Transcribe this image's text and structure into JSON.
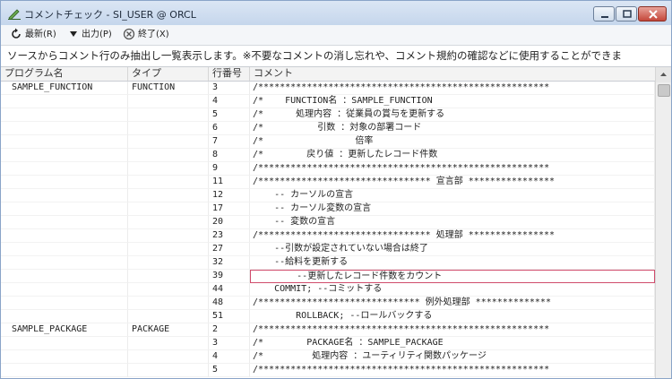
{
  "window": {
    "title": "コメントチェック - SI_USER @ ORCL",
    "controls": {
      "minimize_icon": "minimize-icon",
      "maximize_icon": "maximize-icon",
      "close_icon": "close-icon"
    }
  },
  "toolbar": {
    "refresh_label": "最新(R)",
    "output_label": "出力(P)",
    "exit_label": "終了(X)"
  },
  "info_text": "ソースからコメント行のみ抽出し一覧表示します。※不要なコメントの消し忘れや、コメント規約の確認などに使用することができま",
  "grid": {
    "columns": [
      "プログラム名",
      "タイプ",
      "行番号",
      "コメント"
    ],
    "rows": [
      {
        "program": "SAMPLE_FUNCTION",
        "type": "FUNCTION",
        "line": "3",
        "comment": "/******************************************************"
      },
      {
        "program": "",
        "type": "",
        "line": "4",
        "comment": "/*    FUNCTION名 ：SAMPLE_FUNCTION"
      },
      {
        "program": "",
        "type": "",
        "line": "5",
        "comment": "/*      処理内容 ：従業員の賞与を更新する"
      },
      {
        "program": "",
        "type": "",
        "line": "6",
        "comment": "/*          引数 ：対象の部署コード"
      },
      {
        "program": "",
        "type": "",
        "line": "7",
        "comment": "/*                 倍率"
      },
      {
        "program": "",
        "type": "",
        "line": "8",
        "comment": "/*        戻り値 ：更新したレコード件数"
      },
      {
        "program": "",
        "type": "",
        "line": "9",
        "comment": "/******************************************************"
      },
      {
        "program": "",
        "type": "",
        "line": "11",
        "comment": "/******************************** 宣言部 ****************"
      },
      {
        "program": "",
        "type": "",
        "line": "12",
        "comment": "    -- カーソルの宣言"
      },
      {
        "program": "",
        "type": "",
        "line": "17",
        "comment": "    -- カーソル変数の宣言"
      },
      {
        "program": "",
        "type": "",
        "line": "20",
        "comment": "    -- 変数の宣言"
      },
      {
        "program": "",
        "type": "",
        "line": "23",
        "comment": "/******************************** 処理部 ****************"
      },
      {
        "program": "",
        "type": "",
        "line": "27",
        "comment": "    --引数が設定されていない場合は終了"
      },
      {
        "program": "",
        "type": "",
        "line": "32",
        "comment": "    --給料を更新する"
      },
      {
        "program": "",
        "type": "",
        "line": "39",
        "comment": "        --更新したレコード件数をカウント"
      },
      {
        "program": "",
        "type": "",
        "line": "44",
        "comment": "    COMMIT; --コミットする"
      },
      {
        "program": "",
        "type": "",
        "line": "48",
        "comment": "/****************************** 例外処理部 **************"
      },
      {
        "program": "",
        "type": "",
        "line": "51",
        "comment": "        ROLLBACK; --ロールバックする"
      },
      {
        "program": "SAMPLE_PACKAGE",
        "type": "PACKAGE",
        "line": "2",
        "comment": "/******************************************************"
      },
      {
        "program": "",
        "type": "",
        "line": "3",
        "comment": "/*        PACKAGE名 ：SAMPLE_PACKAGE"
      },
      {
        "program": "",
        "type": "",
        "line": "4",
        "comment": "/*         処理内容 ：ユーティリティ関数パッケージ"
      },
      {
        "program": "",
        "type": "",
        "line": "5",
        "comment": "/******************************************************"
      }
    ],
    "selected_row": 14
  },
  "colors": {
    "selection_border": "#d04c6c",
    "titlebar": "#c5d6ec",
    "close_button": "#c4473a"
  }
}
